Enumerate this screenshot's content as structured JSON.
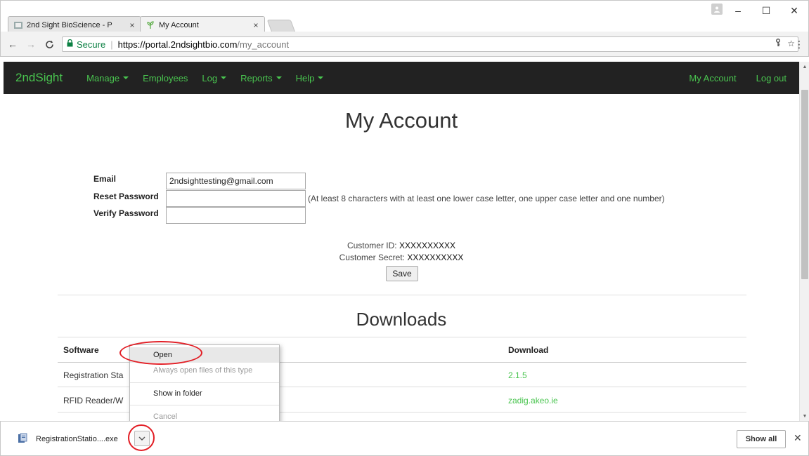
{
  "browser": {
    "tabs": [
      {
        "title": "2nd Sight BioScience - P",
        "active": false
      },
      {
        "title": "My Account",
        "active": true
      }
    ],
    "tab_close": "×",
    "window_controls": {
      "minimize": "–",
      "maximize": "☐",
      "close": "✕"
    },
    "address": {
      "secure_label": "Secure",
      "host": "https://portal.2ndsightbio.com",
      "path": "/my_account"
    }
  },
  "navbar": {
    "brand": "2ndSight",
    "items": [
      "Manage",
      "Employees",
      "Log",
      "Reports",
      "Help"
    ],
    "right_items": [
      "My Account",
      "Log out"
    ]
  },
  "page": {
    "title": "My Account",
    "form": {
      "email_label": "Email",
      "email_value": "2ndsighttesting@gmail.com",
      "reset_label": "Reset Password",
      "verify_label": "Verify Password",
      "password_hint": "(At least 8 characters with at least one lower case letter, one upper case letter and one number)"
    },
    "customer_id_label": "Customer ID:",
    "customer_id_value": "XXXXXXXXXX",
    "customer_secret_label": "Customer Secret:",
    "customer_secret_value": "XXXXXXXXXX",
    "save_label": "Save",
    "downloads_title": "Downloads",
    "table": {
      "headers": [
        "Software",
        "Download"
      ],
      "rows": [
        {
          "software": "Registration Sta",
          "download": "2.1.5"
        },
        {
          "software": "RFID Reader/W",
          "download": "zadig.akeo.ie"
        }
      ]
    }
  },
  "context_menu": {
    "items": [
      "Open",
      "Always open files of this type",
      "Show in folder",
      "Cancel"
    ]
  },
  "download_shelf": {
    "filename": "RegistrationStatio....exe",
    "show_all_label": "Show all",
    "close_glyph": "✕"
  },
  "colors": {
    "brand_green": "#49c44f",
    "navbar_bg": "#222222",
    "annotation_red": "#e21e25",
    "secure_green": "#0b8043"
  }
}
